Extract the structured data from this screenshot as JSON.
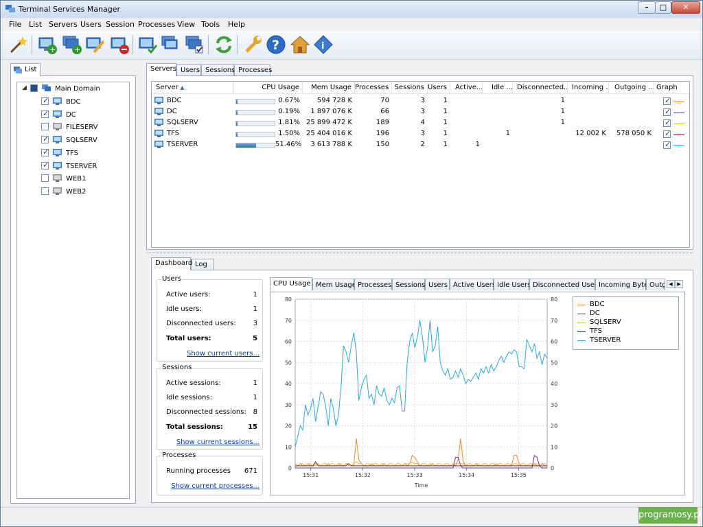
{
  "window": {
    "title": "Terminal Services Manager"
  },
  "menu": [
    "File",
    "List",
    "Servers",
    "Users",
    "Session",
    "Processes",
    "View",
    "Tools",
    "Help"
  ],
  "left_panel": {
    "tab": "List",
    "tree": {
      "root": "Main Domain",
      "items": [
        {
          "name": "BDC",
          "checked": true
        },
        {
          "name": "DC",
          "checked": true
        },
        {
          "name": "FILESERV",
          "checked": false
        },
        {
          "name": "SQLSERV",
          "checked": true
        },
        {
          "name": "TFS",
          "checked": true
        },
        {
          "name": "TSERVER",
          "checked": true
        },
        {
          "name": "WEB1",
          "checked": false
        },
        {
          "name": "WEB2",
          "checked": false
        }
      ]
    }
  },
  "top_tabs": [
    "Servers",
    "Users",
    "Sessions",
    "Processes"
  ],
  "servers_table": {
    "columns": [
      "Server",
      "CPU Usage",
      "Mem Usage",
      "Processes",
      "Sessions",
      "Users",
      "Active...",
      "Idle ...",
      "Disconnected...",
      "Incoming ...",
      "Outgoing ...",
      "Graph"
    ],
    "rows": [
      {
        "server": "BDC",
        "cpu": "0.67%",
        "cpu_pct": 0.67,
        "mem": "594 728 K",
        "processes": "70",
        "sessions": "3",
        "users": "1",
        "active": "",
        "idle": "",
        "disconnected": "1",
        "incoming": "",
        "outgoing": "",
        "graph": true,
        "color": "#e08a2b"
      },
      {
        "server": "DC",
        "cpu": "0.19%",
        "cpu_pct": 0.19,
        "mem": "1 897 076 K",
        "processes": "66",
        "sessions": "3",
        "users": "1",
        "active": "",
        "idle": "",
        "disconnected": "1",
        "incoming": "",
        "outgoing": "",
        "graph": true,
        "color": "#6a2a9c"
      },
      {
        "server": "SQLSERV",
        "cpu": "1.81%",
        "cpu_pct": 1.81,
        "mem": "25 899 472 K",
        "processes": "189",
        "sessions": "4",
        "users": "1",
        "active": "",
        "idle": "",
        "disconnected": "1",
        "incoming": "",
        "outgoing": "",
        "graph": true,
        "color": "#e8b730"
      },
      {
        "server": "TFS",
        "cpu": "1.50%",
        "cpu_pct": 1.5,
        "mem": "25 404 016 K",
        "processes": "196",
        "sessions": "3",
        "users": "1",
        "active": "",
        "idle": "1",
        "disconnected": "",
        "incoming": "12 002 K",
        "outgoing": "578 050 K",
        "graph": true,
        "color": "#8e1e1e"
      },
      {
        "server": "TSERVER",
        "cpu": "51.46%",
        "cpu_pct": 51.46,
        "mem": "3 613 788 K",
        "processes": "150",
        "sessions": "2",
        "users": "1",
        "active": "1",
        "idle": "",
        "disconnected": "",
        "incoming": "",
        "outgoing": "",
        "graph": true,
        "color": "#2aa6d8"
      }
    ]
  },
  "bottom_tabs": [
    "Dashboard",
    "Log"
  ],
  "dashboard": {
    "users": {
      "title": "Users",
      "rows": [
        {
          "label": "Active users:",
          "value": "1"
        },
        {
          "label": "Idle users:",
          "value": "1"
        },
        {
          "label": "Disconnected users:",
          "value": "3"
        },
        {
          "label": "Total users:",
          "value": "5"
        }
      ],
      "link": "Show current users..."
    },
    "sessions": {
      "title": "Sessions",
      "rows": [
        {
          "label": "Active sessions:",
          "value": "1"
        },
        {
          "label": "Idle sessions:",
          "value": "1"
        },
        {
          "label": "Disconnected sessions:",
          "value": "8"
        },
        {
          "label": "Total sessions:",
          "value": "15"
        }
      ],
      "link": "Show current sessions..."
    },
    "processes": {
      "title": "Processes",
      "rows": [
        {
          "label": "Running processes",
          "value": "671"
        }
      ],
      "link": "Show current processes..."
    }
  },
  "chart_tabs": [
    "CPU Usage",
    "Mem Usage",
    "Processes",
    "Sessions",
    "Users",
    "Active Users",
    "Idle Users",
    "Disconnected Users",
    "Incoming Bytes",
    "Outg"
  ],
  "chart_data": {
    "type": "line",
    "title": "",
    "xlabel": "Time",
    "ylabel": "",
    "ylim": [
      0,
      80
    ],
    "yticks": [
      0,
      10,
      20,
      30,
      40,
      50,
      60,
      70,
      80
    ],
    "xticks": [
      "15:31",
      "15:32",
      "15:33",
      "15:34",
      "15:35"
    ],
    "x": [
      0,
      1,
      2,
      3,
      4,
      5,
      6,
      7,
      8,
      9,
      10,
      11,
      12,
      13,
      14,
      15,
      16,
      17,
      18,
      19,
      20,
      21,
      22,
      23,
      24,
      25,
      26,
      27,
      28,
      29,
      30,
      31,
      32,
      33,
      34,
      35,
      36,
      37,
      38,
      39,
      40,
      41,
      42,
      43,
      44,
      45,
      46,
      47,
      48,
      49,
      50,
      51,
      52,
      53,
      54,
      55,
      56,
      57,
      58,
      59,
      60,
      61,
      62,
      63,
      64,
      65,
      66,
      67,
      68,
      69,
      70,
      71,
      72,
      73,
      74,
      75,
      76,
      77,
      78,
      79,
      80,
      81,
      82,
      83,
      84,
      85,
      86,
      87,
      88,
      89,
      90,
      91,
      92,
      93,
      94,
      95,
      96,
      97,
      98,
      99
    ],
    "series": [
      {
        "name": "BDC",
        "color": "#e08a2b",
        "values": [
          1,
          1,
          2,
          1,
          1,
          2,
          1,
          1,
          1,
          2,
          1,
          1,
          1,
          2,
          1,
          1,
          1,
          2,
          1,
          1,
          2,
          1,
          1,
          1,
          14,
          4,
          2,
          1,
          1,
          1,
          2,
          1,
          1,
          1,
          1,
          2,
          1,
          1,
          1,
          1,
          1,
          1,
          1,
          2,
          1,
          2,
          6,
          5,
          3,
          1,
          1,
          1,
          1,
          1,
          2,
          1,
          1,
          1,
          1,
          1,
          1,
          1,
          2,
          1,
          4,
          14,
          3,
          1,
          1,
          1,
          1,
          2,
          1,
          1,
          1,
          1,
          1,
          1,
          1,
          2,
          1,
          1,
          1,
          1,
          1,
          1,
          6,
          6,
          2,
          1,
          1,
          1,
          1,
          1,
          2,
          1,
          1,
          2,
          1,
          1
        ]
      },
      {
        "name": "DC",
        "color": "#6a2a9c",
        "values": [
          0,
          0,
          0,
          0,
          0,
          0,
          0,
          0,
          0,
          0,
          0,
          0,
          0,
          0,
          0,
          0,
          0,
          0,
          0,
          0,
          0,
          0,
          0,
          0,
          0,
          0,
          0,
          0,
          0,
          0,
          0,
          0,
          0,
          0,
          0,
          0,
          0,
          0,
          0,
          0,
          0,
          0,
          0,
          0,
          0,
          0,
          0,
          0,
          0,
          0,
          0,
          0,
          0,
          0,
          0,
          0,
          0,
          0,
          0,
          0,
          0,
          0,
          0,
          5,
          5,
          1,
          0,
          0,
          0,
          0,
          0,
          0,
          0,
          0,
          0,
          0,
          0,
          0,
          0,
          0,
          0,
          0,
          0,
          0,
          0,
          0,
          0,
          0,
          0,
          0,
          0,
          0,
          0,
          0,
          6,
          5,
          1,
          0,
          0,
          0
        ]
      },
      {
        "name": "SQLSERV",
        "color": "#e8b730",
        "values": [
          2,
          1,
          2,
          2,
          1,
          2,
          2,
          1,
          2,
          2,
          1,
          2,
          2,
          1,
          2,
          2,
          1,
          2,
          2,
          1,
          2,
          2,
          1,
          2,
          3,
          2,
          2,
          1,
          2,
          2,
          1,
          2,
          2,
          1,
          2,
          2,
          1,
          2,
          2,
          1,
          2,
          2,
          1,
          2,
          2,
          2,
          3,
          2,
          2,
          1,
          2,
          2,
          1,
          2,
          2,
          1,
          2,
          2,
          1,
          2,
          2,
          1,
          2,
          2,
          2,
          2,
          2,
          1,
          2,
          2,
          1,
          2,
          2,
          1,
          2,
          2,
          1,
          2,
          2,
          1,
          2,
          2,
          1,
          2,
          2,
          1,
          2,
          2,
          1,
          2,
          2,
          1,
          2,
          2,
          2,
          2,
          1,
          2,
          2,
          1
        ]
      },
      {
        "name": "TFS",
        "color": "#8e1e1e",
        "values": [
          1,
          1,
          1,
          1,
          1,
          1,
          1,
          1,
          3,
          1,
          1,
          1,
          1,
          1,
          1,
          1,
          1,
          1,
          1,
          1,
          1,
          2,
          1,
          1,
          1,
          1,
          1,
          1,
          1,
          1,
          1,
          1,
          1,
          1,
          1,
          1,
          1,
          1,
          1,
          1,
          1,
          1,
          1,
          1,
          1,
          1,
          1,
          1,
          1,
          1,
          1,
          1,
          1,
          1,
          1,
          1,
          1,
          1,
          1,
          1,
          1,
          1,
          1,
          1,
          1,
          1,
          1,
          1,
          1,
          1,
          1,
          1,
          1,
          1,
          1,
          1,
          1,
          1,
          1,
          1,
          1,
          1,
          1,
          1,
          1,
          1,
          1,
          1,
          1,
          1,
          1,
          1,
          1,
          1,
          1,
          1,
          1,
          1,
          1,
          1
        ]
      },
      {
        "name": "TSERVER",
        "color": "#2aa6d8",
        "values": [
          10,
          15,
          20,
          18,
          30,
          25,
          28,
          33,
          22,
          29,
          36,
          35,
          29,
          20,
          33,
          28,
          20,
          25,
          38,
          58,
          55,
          50,
          58,
          64,
          55,
          32,
          38,
          42,
          44,
          33,
          35,
          30,
          39,
          35,
          34,
          38,
          32,
          30,
          33,
          31,
          38,
          39,
          27,
          27,
          50,
          60,
          64,
          57,
          62,
          70,
          62,
          50,
          57,
          70,
          55,
          58,
          67,
          50,
          46,
          44,
          47,
          42,
          43,
          46,
          43,
          47,
          44,
          40,
          42,
          41,
          43,
          45,
          42,
          47,
          45,
          48,
          45,
          49,
          46,
          48,
          51,
          53,
          50,
          53,
          55,
          54,
          56,
          55,
          48,
          48,
          47,
          61,
          58,
          55,
          59,
          52,
          55,
          49,
          54,
          52
        ]
      }
    ]
  }
}
